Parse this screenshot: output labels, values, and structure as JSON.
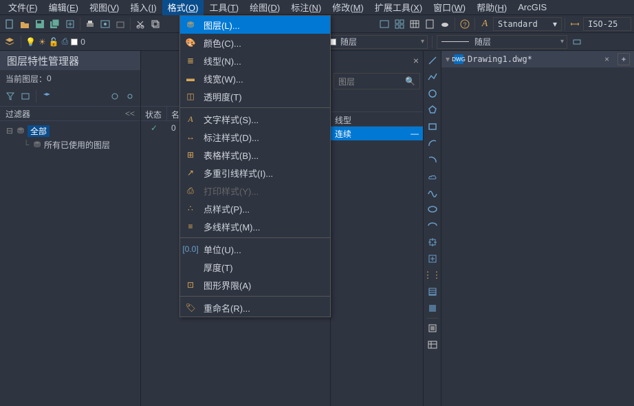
{
  "menubar": [
    {
      "label": "文件(F)",
      "hot": "F"
    },
    {
      "label": "编辑(E)",
      "hot": "E"
    },
    {
      "label": "视图(V)",
      "hot": "V"
    },
    {
      "label": "插入(I)",
      "hot": "I"
    },
    {
      "label": "格式(O)",
      "hot": "O",
      "active": true
    },
    {
      "label": "工具(T)",
      "hot": "T"
    },
    {
      "label": "绘图(D)",
      "hot": "D"
    },
    {
      "label": "标注(N)",
      "hot": "N"
    },
    {
      "label": "修改(M)",
      "hot": "M"
    },
    {
      "label": "扩展工具(X)",
      "hot": "X"
    },
    {
      "label": "窗口(W)",
      "hot": "W"
    },
    {
      "label": "帮助(H)",
      "hot": "H"
    },
    {
      "label": "ArcGIS",
      "plain": true
    }
  ],
  "toolbar": {
    "style_label": "Standard",
    "dim_label": "ISO-25"
  },
  "layerbar": {
    "current_layer": "0",
    "bylayer1": "随层",
    "bylayer2": "随层"
  },
  "format_menu": {
    "items": [
      {
        "id": "layer",
        "label": "图层(L)...",
        "highlight": true
      },
      {
        "id": "color",
        "label": "颜色(C)..."
      },
      {
        "id": "linetype",
        "label": "线型(N)..."
      },
      {
        "id": "lineweight",
        "label": "线宽(W)..."
      },
      {
        "id": "transparency",
        "label": "透明度(T)"
      },
      {
        "sep": true
      },
      {
        "id": "textstyle",
        "label": "文字样式(S)..."
      },
      {
        "id": "dimstyle",
        "label": "标注样式(D)..."
      },
      {
        "id": "tablestyle",
        "label": "表格样式(B)..."
      },
      {
        "id": "mleaderstyle",
        "label": "多重引线样式(I)..."
      },
      {
        "id": "plotstyle",
        "label": "打印样式(Y)...",
        "disabled": true
      },
      {
        "id": "pointstyle",
        "label": "点样式(P)..."
      },
      {
        "id": "mlinestyle",
        "label": "多线样式(M)..."
      },
      {
        "sep": true
      },
      {
        "id": "units",
        "label": "单位(U)..."
      },
      {
        "id": "thickness",
        "label": "厚度(T)"
      },
      {
        "id": "limits",
        "label": "图形界限(A)"
      },
      {
        "sep": true
      },
      {
        "id": "rename",
        "label": "重命名(R)..."
      }
    ]
  },
  "layer_panel": {
    "title": "图层特性管理器",
    "current_label": "当前图层：",
    "current_value": "0",
    "filter_header": "过滤器",
    "collapse": "<<",
    "tree": {
      "root": "全部",
      "child": "所有已使用的图层"
    },
    "grid_headers": [
      "状态",
      "名"
    ],
    "grid_row": {
      "status": "✓",
      "name": "0"
    }
  },
  "right_panel": {
    "close_x": "×",
    "search_placeholder": "图层",
    "col_header": "线型",
    "row_value": "连续",
    "row_dash": "—"
  },
  "document": {
    "name": "Drawing1.dwg*"
  }
}
